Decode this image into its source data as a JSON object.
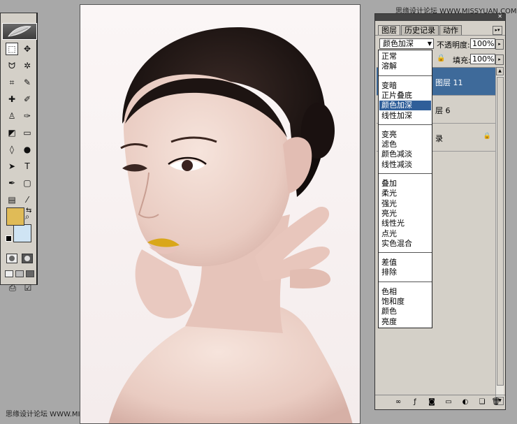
{
  "watermark": "思缘设计论坛 WWW.MISSYUAN.COM",
  "toolbox": {
    "tools": [
      {
        "name": "marquee-tool-icon",
        "glyph": "⬚"
      },
      {
        "name": "move-tool-icon",
        "glyph": "✥"
      },
      {
        "name": "lasso-tool-icon",
        "glyph": "ᗢ"
      },
      {
        "name": "magic-wand-tool-icon",
        "glyph": "✲"
      },
      {
        "name": "crop-tool-icon",
        "glyph": "⌗"
      },
      {
        "name": "slice-tool-icon",
        "glyph": "✎"
      },
      {
        "name": "healing-brush-tool-icon",
        "glyph": "✚"
      },
      {
        "name": "brush-tool-icon",
        "glyph": "✐"
      },
      {
        "name": "clone-stamp-tool-icon",
        "glyph": "♙"
      },
      {
        "name": "history-brush-tool-icon",
        "glyph": "✑"
      },
      {
        "name": "eraser-tool-icon",
        "glyph": "◩"
      },
      {
        "name": "gradient-tool-icon",
        "glyph": "▭"
      },
      {
        "name": "blur-tool-icon",
        "glyph": "◊"
      },
      {
        "name": "dodge-tool-icon",
        "glyph": "●"
      },
      {
        "name": "path-selection-tool-icon",
        "glyph": "➤"
      },
      {
        "name": "type-tool-icon",
        "glyph": "T"
      },
      {
        "name": "pen-tool-icon",
        "glyph": "✒"
      },
      {
        "name": "shape-tool-icon",
        "glyph": "▢"
      },
      {
        "name": "notes-tool-icon",
        "glyph": "▤"
      },
      {
        "name": "eyedropper-tool-icon",
        "glyph": "⁄"
      },
      {
        "name": "hand-tool-icon",
        "glyph": "✋"
      },
      {
        "name": "zoom-tool-icon",
        "glyph": "⌕"
      }
    ],
    "foreground_color": "#e0bb57",
    "background_color": "#cfe4f4"
  },
  "layers_panel": {
    "tabs": [
      "图层",
      "历史记录",
      "动作"
    ],
    "blend_mode": "颜色加深",
    "opacity_label": "不透明度:",
    "opacity_value": "100%",
    "fill_label": "填充:",
    "fill_value": "100%",
    "layers": [
      {
        "name": "图层 11",
        "selected": true
      },
      {
        "name": "层 6",
        "selected": false
      },
      {
        "name": "录",
        "selected": false
      }
    ]
  },
  "blend_dropdown": {
    "groups": [
      [
        "正常",
        "溶解"
      ],
      [
        "变暗",
        "正片叠底",
        "颜色加深",
        "线性加深"
      ],
      [
        "变亮",
        "滤色",
        "颜色减淡",
        "线性减淡"
      ],
      [
        "叠加",
        "柔光",
        "强光",
        "亮光",
        "线性光",
        "点光",
        "实色混合"
      ],
      [
        "差值",
        "排除"
      ],
      [
        "色相",
        "饱和度",
        "颜色",
        "亮度"
      ]
    ],
    "selected": "颜色加深"
  }
}
